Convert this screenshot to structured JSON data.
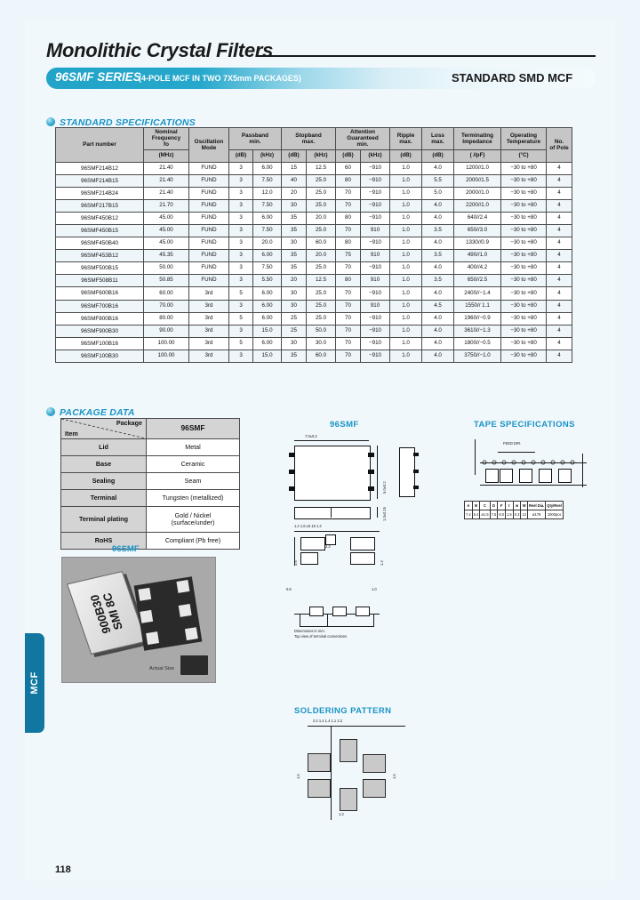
{
  "header": {
    "doc_title": "Monolithic Crystal Filters",
    "series": "96SMF SERIES",
    "series_sub": "(4-POLE MCF IN TWO 7X5mm PACKAGES)",
    "series_right": "STANDARD SMD MCF",
    "accent_color": "#1b93c4",
    "tab_color": "#1277a0"
  },
  "sections": {
    "specs": "STANDARD SPECIFICATIONS",
    "package": "PACKAGE DATA"
  },
  "spec_table": {
    "headers": {
      "part_number": "Part number",
      "nominal_frequency": "Nominal\nFrequency\nfo",
      "nominal_frequency_l1": "Nominal",
      "nominal_frequency_l2": "Frequency",
      "nominal_frequency_l3": "fo",
      "oscillation_mode_l1": "Oscillation",
      "oscillation_mode_l2": "Mode",
      "passband_l1": "Passband",
      "passband_l2": "min.",
      "stopband_l1": "Stopband",
      "stopband_l2": "max.",
      "attention_l1": "Attention",
      "attention_l2": "Guaranteed",
      "attention_l3": "min.",
      "ripple_l1": "Ripple",
      "ripple_l2": "max.",
      "loss_l1": "Loss",
      "loss_l2": "max.",
      "terminating_l1": "Terminating",
      "terminating_l2": "Impedance",
      "operating_l1": "Operating",
      "operating_l2": "Temperature",
      "pole_l1": "No.",
      "pole_l2": "of Pole"
    },
    "units": {
      "freq": "(MHz)",
      "pb_db": "(dB)",
      "pb_khz": "(kHz)",
      "sb_db": "(dB)",
      "sb_khz": "(kHz)",
      "att_db": "(dB)",
      "att_khz": "(kHz)",
      "ripple": "(dB)",
      "loss": "(dB)",
      "impedance": "(    //pF)",
      "temperature": "(°C)"
    },
    "rows": [
      {
        "pn": "96SMF214B12",
        "fo": "21.40",
        "mode": "FUND",
        "pb_db": "3",
        "pb_khz": "6.00",
        "sb_db": "15",
        "sb_khz": "12.5",
        "att_db": "60",
        "att_khz": "−910",
        "ripple": "1.0",
        "loss": "4.0",
        "imp": "1200//1.0",
        "temp": "−30 to +80",
        "pole": "4"
      },
      {
        "pn": "96SMF214B15",
        "fo": "21.40",
        "mode": "FUND",
        "pb_db": "3",
        "pb_khz": "7.50",
        "sb_db": "40",
        "sb_khz": "25.0",
        "att_db": "80",
        "att_khz": "−910",
        "ripple": "1.0",
        "loss": "5.5",
        "imp": "2000//1.5",
        "temp": "−30 to +80",
        "pole": "4"
      },
      {
        "pn": "96SMF214B24",
        "fo": "21.40",
        "mode": "FUND",
        "pb_db": "3",
        "pb_khz": "12.0",
        "sb_db": "20",
        "sb_khz": "25.0",
        "att_db": "70",
        "att_khz": "−910",
        "ripple": "1.0",
        "loss": "5.0",
        "imp": "2000//1.0",
        "temp": "−30 to +80",
        "pole": "4"
      },
      {
        "pn": "96SMF217B15",
        "fo": "21.70",
        "mode": "FUND",
        "pb_db": "3",
        "pb_khz": "7.50",
        "sb_db": "30",
        "sb_khz": "25.0",
        "att_db": "70",
        "att_khz": "−910",
        "ripple": "1.0",
        "loss": "4.0",
        "imp": "2200//1.0",
        "temp": "−30 to +80",
        "pole": "4"
      },
      {
        "pn": "96SMF450B12",
        "fo": "45.00",
        "mode": "FUND",
        "pb_db": "3",
        "pb_khz": "6.00",
        "sb_db": "35",
        "sb_khz": "20.0",
        "att_db": "80",
        "att_khz": "−910",
        "ripple": "1.0",
        "loss": "4.0",
        "imp": "640//2.4",
        "temp": "−30 to +80",
        "pole": "4"
      },
      {
        "pn": "96SMF450B15",
        "fo": "45.00",
        "mode": "FUND",
        "pb_db": "3",
        "pb_khz": "7.50",
        "sb_db": "35",
        "sb_khz": "25.0",
        "att_db": "70",
        "att_khz": "910",
        "ripple": "1.0",
        "loss": "3.5",
        "imp": "650//3.0",
        "temp": "−30 to +80",
        "pole": "4"
      },
      {
        "pn": "96SMF450B40",
        "fo": "45.00",
        "mode": "FUND",
        "pb_db": "3",
        "pb_khz": "20.0",
        "sb_db": "30",
        "sb_khz": "60.0",
        "att_db": "80",
        "att_khz": "−910",
        "ripple": "1.0",
        "loss": "4.0",
        "imp": "1330//0.9",
        "temp": "−30 to +80",
        "pole": "4"
      },
      {
        "pn": "96SMF453B12",
        "fo": "45.35",
        "mode": "FUND",
        "pb_db": "3",
        "pb_khz": "6.00",
        "sb_db": "35",
        "sb_khz": "20.0",
        "att_db": "75",
        "att_khz": "910",
        "ripple": "1.0",
        "loss": "3.5",
        "imp": "490//1.0",
        "temp": "−30 to +80",
        "pole": "4"
      },
      {
        "pn": "96SMF500B15",
        "fo": "50.00",
        "mode": "FUND",
        "pb_db": "3",
        "pb_khz": "7.50",
        "sb_db": "35",
        "sb_khz": "25.0",
        "att_db": "70",
        "att_khz": "−910",
        "ripple": "1.0",
        "loss": "4.0",
        "imp": "400//4.2",
        "temp": "−30 to +80",
        "pole": "4"
      },
      {
        "pn": "96SMF508B11",
        "fo": "50.85",
        "mode": "FUND",
        "pb_db": "3",
        "pb_khz": "5.50",
        "sb_db": "20",
        "sb_khz": "12.5",
        "att_db": "80",
        "att_khz": "910",
        "ripple": "1.0",
        "loss": "3.5",
        "imp": "650//2.5",
        "temp": "−30 to +80",
        "pole": "4"
      },
      {
        "pn": "96SMF600B16",
        "fo": "60.00",
        "mode": "3rd",
        "pb_db": "5",
        "pb_khz": "6.00",
        "sb_db": "30",
        "sb_khz": "25.0",
        "att_db": "70",
        "att_khz": "−910",
        "ripple": "1.0",
        "loss": "4.0",
        "imp": "2400//−1.4",
        "temp": "−30 to +80",
        "pole": "4"
      },
      {
        "pn": "96SMF700B16",
        "fo": "70.00",
        "mode": "3rd",
        "pb_db": "3",
        "pb_khz": "6.00",
        "sb_db": "30",
        "sb_khz": "25.0",
        "att_db": "70",
        "att_khz": "910",
        "ripple": "1.0",
        "loss": "4.5",
        "imp": "1550// 1.1",
        "temp": "−30 to +80",
        "pole": "4"
      },
      {
        "pn": "96SMF800B16",
        "fo": "80.00",
        "mode": "3rd",
        "pb_db": "5",
        "pb_khz": "6.00",
        "sb_db": "25",
        "sb_khz": "25.0",
        "att_db": "70",
        "att_khz": "−910",
        "ripple": "1.0",
        "loss": "4.0",
        "imp": "1960//−0.9",
        "temp": "−30 to +80",
        "pole": "4"
      },
      {
        "pn": "96SMF900B30",
        "fo": "90.00",
        "mode": "3rd",
        "pb_db": "3",
        "pb_khz": "15.0",
        "sb_db": "25",
        "sb_khz": "50.0",
        "att_db": "70",
        "att_khz": "−910",
        "ripple": "1.0",
        "loss": "4.0",
        "imp": "3610//−1.3",
        "temp": "−30 to +80",
        "pole": "4"
      },
      {
        "pn": "96SMF100B16",
        "fo": "100.00",
        "mode": "3rd",
        "pb_db": "5",
        "pb_khz": "6.00",
        "sb_db": "30",
        "sb_khz": "30.0",
        "att_db": "70",
        "att_khz": "−910",
        "ripple": "1.0",
        "loss": "4.0",
        "imp": "1800//−0.5",
        "temp": "−30 to +80",
        "pole": "4"
      },
      {
        "pn": "96SMF100B30",
        "fo": "100.00",
        "mode": "3rd",
        "pb_db": "3",
        "pb_khz": "15.0",
        "sb_db": "35",
        "sb_khz": "60.0",
        "att_db": "70",
        "att_khz": "−910",
        "ripple": "1.0",
        "loss": "4.0",
        "imp": "3750//−1.0",
        "temp": "−30 to +80",
        "pole": "4"
      }
    ]
  },
  "package_table": {
    "corner_item": "Item",
    "corner_package": "Package",
    "column": "96SMF",
    "rows": [
      {
        "k": "Lid",
        "v": "Metal"
      },
      {
        "k": "Base",
        "v": "Ceramic"
      },
      {
        "k": "Sealing",
        "v": "Seam"
      },
      {
        "k": "Terminal",
        "v": "Tungsten (metallized)"
      },
      {
        "k": "Terminal plating",
        "v": "Gold / Nickel\n(surface/under)"
      },
      {
        "k": "RoHS",
        "v": "Compliant (Pb free)"
      }
    ],
    "terminal_plating_l1": "Gold / Nickel",
    "terminal_plating_l2": "(surface/under)"
  },
  "photo": {
    "title": "96SMF",
    "marking_l1": "900B30",
    "marking_l2": "SMI 8C",
    "actual_size": "Actual Size"
  },
  "drawing": {
    "title": "96SMF",
    "top_width": "7.0±0.2",
    "side_height": "5.0±0.2",
    "thickness": "1.3±0.15",
    "pad_row": "1.2  1.8  ±0.15  1.2",
    "note_l1": "Dimensions in mm.",
    "note_l2": "Top view of terminal connections",
    "d1": "0.5",
    "d2": "1.3",
    "d3": "2.2",
    "d4": "0.8",
    "d5": "1.0"
  },
  "tape": {
    "title": "TAPE  SPECIFICATIONS",
    "feed_label": "FEED\nDIR.",
    "headers": [
      "A",
      "B",
      "C",
      "D",
      "F",
      "t",
      "w",
      "W",
      "Reel Dia.",
      "Qty/Reel"
    ],
    "values": [
      "7.4",
      "5.4",
      "ø1.5",
      "7.5",
      "8.0",
      "1.5",
      "0.3",
      "12",
      "ø178",
      "1000pcs"
    ]
  },
  "soldering": {
    "title": "SOLDERING PATTERN",
    "dim_top": "2.2    1.4   1.4   1.1    2.2",
    "dim_left": "1.6",
    "dim_right": "1.6",
    "dim_bottom": "1.3",
    "dim_pitch": "1.6"
  },
  "footer": {
    "tab_label": "MCF",
    "page_number": "118"
  }
}
